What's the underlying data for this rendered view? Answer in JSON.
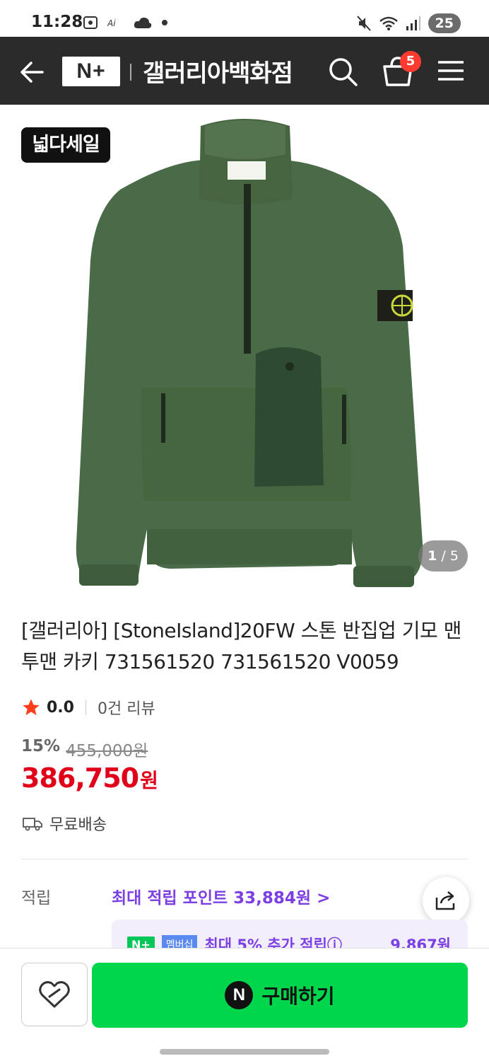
{
  "status_bar": {
    "time": "11:28",
    "battery": "25",
    "small_label": "ⓐⓘ"
  },
  "header": {
    "logo_text": "N+",
    "store_name": "갤러리아백화점",
    "cart_count": "5"
  },
  "product": {
    "sale_badge": "넓다세일",
    "image_counter_current": "1",
    "image_counter_total": "/ 5",
    "title": "[갤러리아] [StoneIsland]20FW 스톤 반집업 기모 맨투맨 카키 731561520 731561520 V0059",
    "rating": "0.0",
    "review_count": "0건 리뷰",
    "discount_rate": "15%",
    "original_price": "455,000원",
    "sale_price": "386,750",
    "sale_unit": "원",
    "shipping": "무료배송"
  },
  "points": {
    "label": "적립",
    "link_text": "최대 적립 포인트 33,884원 >",
    "membership_chip": "N+",
    "membership_tag": "멤버십",
    "membership_text": "최대 5% 추가 적립ⓘ",
    "membership_amount": "9,867원"
  },
  "bottom_bar": {
    "buy_label": "구매하기",
    "naver_mark": "N"
  },
  "colors": {
    "header_bg": "#2b2b2b",
    "price_red": "#e1001a",
    "points_purple": "#7b3fe4",
    "buy_green": "#00d64b",
    "jacket_green": "#4a6b48"
  }
}
